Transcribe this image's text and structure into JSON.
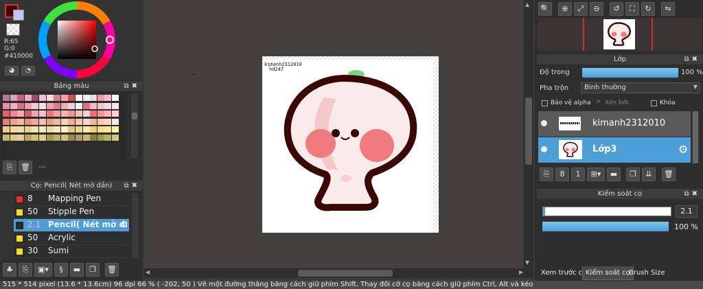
{
  "color": {
    "r_label": "R:65",
    "g_label": "G:0",
    "hex_label": "#410000",
    "current": "#410000"
  },
  "palette": {
    "title": "Bảng màu",
    "footer_text": "---",
    "colors": [
      "#b07a9a",
      "#d9a0b8",
      "#c8607a",
      "#e0b0c0",
      "#a04870",
      "#e8c8d8",
      "#f8d8e0",
      "#d08090",
      "#f0a0b0",
      "#c85060",
      "#ffffff",
      "#f0f0f0",
      "#e8d8e0",
      "#e8a0a8",
      "#f0c0c8",
      "#ffffff",
      "#e890a0",
      "#f0b0c0",
      "#d87088",
      "#e8a0b0",
      "#f8c8d0",
      "#f8e0e8",
      "#f0a0a8",
      "#e07890",
      "#e8b0b8",
      "#f8d0d8",
      "#fff0f0",
      "#e07080",
      "#f8b8c0",
      "#f0c8d0",
      "#fad8e0",
      "#f8e8ec",
      "#e86070",
      "#f08890",
      "#f8a8b0",
      "#d85868",
      "#f0a8b0",
      "#f8c0c8",
      "#e87880",
      "#f0a0a0",
      "#f8b0b0",
      "#e89898",
      "#f0c0c0",
      "#f8d0d0",
      "#e87070",
      "#f09898",
      "#f8b8b8",
      "#fcd0d0",
      "#e88070",
      "#f0a088",
      "#f8b8a0",
      "#e89080",
      "#f0a898",
      "#f8c0b0",
      "#e8a088",
      "#f0b8a0",
      "#f8d0b8",
      "#e8b098",
      "#f0c8b0",
      "#f8d8c8",
      "#f0b8a0",
      "#f8c8b0",
      "#f8d8c0",
      "#fce8d8",
      "#f0c890",
      "#f8d8a0",
      "#f0e0b0",
      "#e8d098",
      "#f8e0b0",
      "#f8e8c0",
      "#f0d8a8",
      "#f8e8b8",
      "#fff0c8",
      "#e8c880",
      "#f0d890",
      "#f8e8a8",
      "#f0d070",
      "#f8e088",
      "#fce898",
      "#fff0b0",
      "#c8b870",
      "#d8c880",
      "#e0d090",
      "#b8a860",
      "#d0c078",
      "#e0d088",
      "#a89858",
      "#c0b070",
      "#d0c080",
      "#988850",
      "#b0a060",
      "#c8b878",
      "#888040",
      "#a09850",
      "#b8b068",
      "#d0c880"
    ]
  },
  "brush_panel": {
    "title": "Cọ: Pencil( Nét mờ dần)",
    "items": [
      {
        "color": "#e83030",
        "size": "8",
        "name": "Mapping Pen"
      },
      {
        "color": "#f0e020",
        "size": "50",
        "name": "Stipple Pen"
      },
      {
        "color": "#2a2a2a",
        "size": "2.1",
        "name": "Pencil( Nét mờ dần)"
      },
      {
        "color": "#f0e020",
        "size": "50",
        "name": "Acrylic"
      },
      {
        "color": "#f0e020",
        "size": "30",
        "name": "Sumi"
      }
    ]
  },
  "canvas": {
    "watermark_line1": "kimanh2312010",
    "watermark_line2": "hd247"
  },
  "layers": {
    "title": "Lớp",
    "opacity_label": "Độ trong",
    "opacity_value": "100 %",
    "opacity_pct": 100,
    "blend_label": "Pha trộn",
    "blend_value": "Bình thường",
    "protect_alpha": "Bảo vệ alpha",
    "clipping": "Xén bớt",
    "lock": "Khóa",
    "items": [
      {
        "name": "kimanh2312010",
        "selected": false
      },
      {
        "name": "Lớp3",
        "selected": true
      }
    ]
  },
  "brush_control": {
    "title": "Kiểm soát cọ",
    "size_value": "2.1",
    "opacity_value": "100 %",
    "opacity_pct": 100
  },
  "tabs": [
    "Xem trước cọ",
    "Kiểm soát cọ",
    "Brush Size"
  ],
  "status": {
    "text": "515 * 514 pixel   (13.6 * 13.6cm)   96 dpi   66 %   ( -202, 50 )   Vẽ một đường thẳng bằng cách giữ phím Shift. Thay đổi cỡ cọ bằng cách giữ phím Ctrl, Alt và kéo"
  }
}
